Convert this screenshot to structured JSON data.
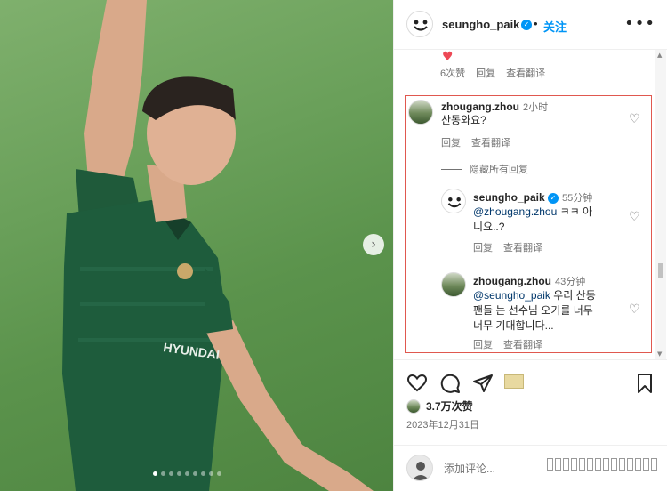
{
  "post": {
    "carousel": {
      "dots": 9,
      "active_dot": 0
    }
  },
  "header": {
    "username": "seungho_paik",
    "verified": true,
    "separator": "•",
    "follow_label": "关注",
    "more": "•••"
  },
  "prev_comment_meta": {
    "likes": "6次赞",
    "reply": "回复",
    "translate": "查看翻译"
  },
  "comments": [
    {
      "username": "zhougang.zhou",
      "time": "2小时",
      "text": "산동와요?",
      "reply": "回复",
      "translate": "查看翻译"
    }
  ],
  "hide_replies": "隐藏所有回复",
  "replies": [
    {
      "username": "seungho_paik",
      "time": "55分钟",
      "mention": "@zhougang.zhou",
      "text_line1": " ㅋㅋ 아",
      "text_line2": "니요..?",
      "reply": "回复",
      "translate": "查看翻译"
    },
    {
      "username": "zhougang.zhou",
      "time": "43分钟",
      "mention": "@seungho_paik",
      "text_line1": " 우리 산동",
      "text_line2": "팬들 는 선수님 오기를 너무",
      "text_line3": "너무 기대합니다...",
      "reply": "回复",
      "translate": "查看翻译"
    }
  ],
  "likes_count": "3.7万次赞",
  "date": "2023年12月31日",
  "add_comment_placeholder": "添加评论...",
  "icons": {
    "like": "heart-outline-icon",
    "comment": "comment-bubble-icon",
    "share": "paper-plane-icon",
    "save": "bookmark-icon",
    "next": "chevron-right-icon"
  },
  "colors": {
    "accent": "#0095f6",
    "highlight_box": "#e0584f",
    "like_red": "#ed4956"
  }
}
